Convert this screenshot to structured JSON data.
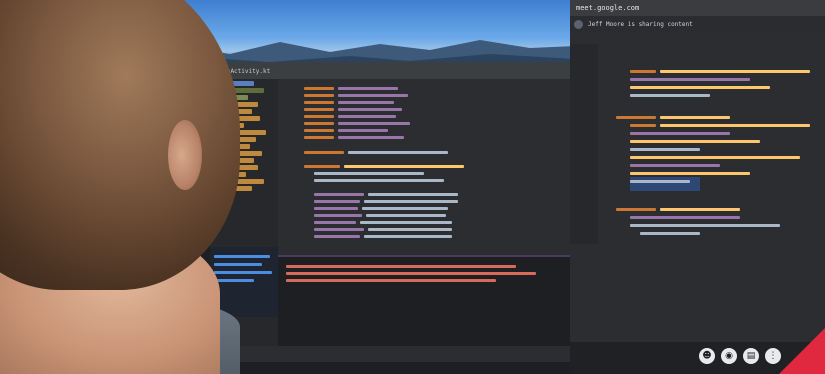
{
  "browser": {
    "address_text": "meet.google.com",
    "sharing_text": "Jeff Moore is sharing content"
  },
  "ide": {
    "toolbar_text": "MainActivity.kt"
  },
  "colors": {
    "keyword": "#cc7832",
    "variable": "#9876aa",
    "function": "#ffc66d",
    "text": "#a9b7c6",
    "error": "#d86a5c",
    "selection": "#2e4e88",
    "accent_red": "#e0283e"
  },
  "icons": [
    "person-icon",
    "camera-icon",
    "caption-icon",
    "more-icon"
  ]
}
